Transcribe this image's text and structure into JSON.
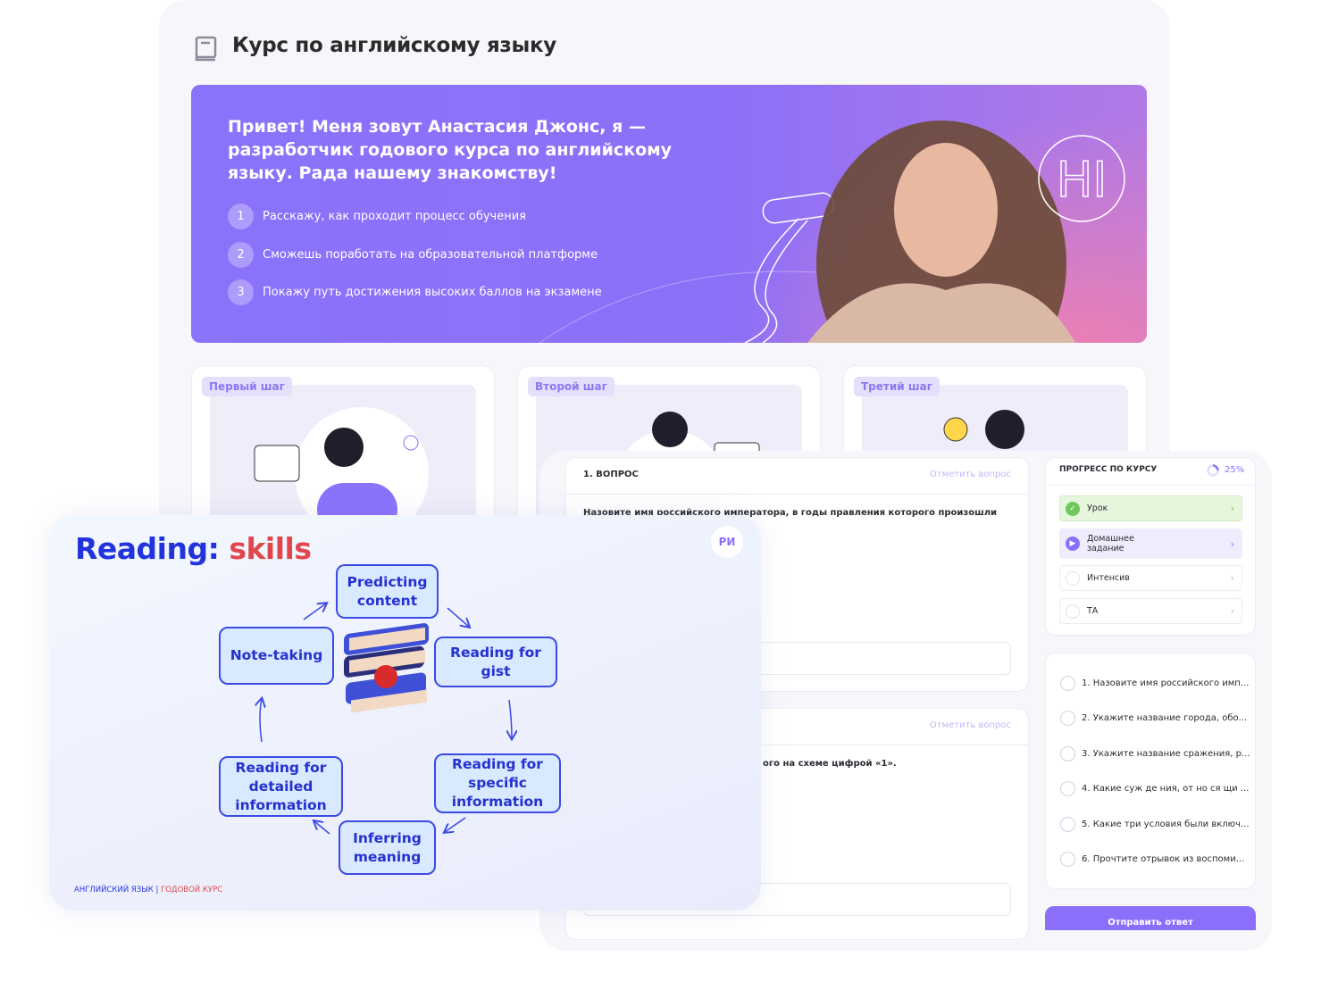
{
  "page": {
    "title": "Курс по английскому языку",
    "title_icon": "book-icon"
  },
  "banner": {
    "heading": "Привет! Меня зовут Анастасия Джонс, я — разработчик годового курса по английскому языку. Рада нашему знакомству!",
    "steps": [
      {
        "num": "1",
        "text": "Расскажу, как проходит процесс обучения"
      },
      {
        "num": "2",
        "text": "Сможешь поработать на образовательной платформе"
      },
      {
        "num": "3",
        "text": "Покажу путь достижения высоких баллов на экзамене"
      }
    ],
    "hi_bubble": "HI",
    "colors": {
      "start": "#8b72fb",
      "end": "#ea80b4"
    }
  },
  "cards": [
    {
      "tag": "Первый шаг"
    },
    {
      "tag": "Второй шаг"
    },
    {
      "tag": "Третий шаг"
    }
  ],
  "question1": {
    "label": "1. ВОПРОС",
    "mark": "Отметить вопрос",
    "text": "Назовите имя российского императора, в годы правления которого произошли события,"
  },
  "question2": {
    "mark": "Отметить вопрос",
    "text_fragment": "ого на схеме цифрой «1»."
  },
  "progress": {
    "title": "ПРОГРЕСС ПО КУРСУ",
    "percent": "25%",
    "value": 25,
    "items": [
      {
        "label": "Урок",
        "status": "done"
      },
      {
        "label": "Домашнее задание",
        "status": "in-progress"
      },
      {
        "label": "Интенсив",
        "status": "todo"
      },
      {
        "label": "ТА",
        "status": "todo"
      }
    ]
  },
  "questions_list": [
    "1. Назовите имя российского имп...",
    "2. Укажите название города, обо...",
    "3. Укажите название сражения, р...",
    "4. Какие суж де ния, от но ся щи ...",
    "5. Какие три условия были включ...",
    "6. Прочтите отрывок из воспоми..."
  ],
  "submit_label": "Отправить ответ",
  "slide": {
    "title_a": "Reading:",
    "title_b": "skills",
    "logo": "РИ",
    "skills": [
      "Predicting content",
      "Reading for gist",
      "Reading for specific information",
      "Inferring meaning",
      "Reading for detailed information",
      "Note-taking"
    ],
    "footer_a": "АНГЛИЙСКИЙ ЯЗЫК",
    "footer_sep": " | ",
    "footer_b": "ГОДОВОЙ КУРС",
    "colors": {
      "blue": "#2233dd",
      "red": "#e0474c",
      "box": "#d9e9ff"
    }
  },
  "accent": "#8b6ffb"
}
